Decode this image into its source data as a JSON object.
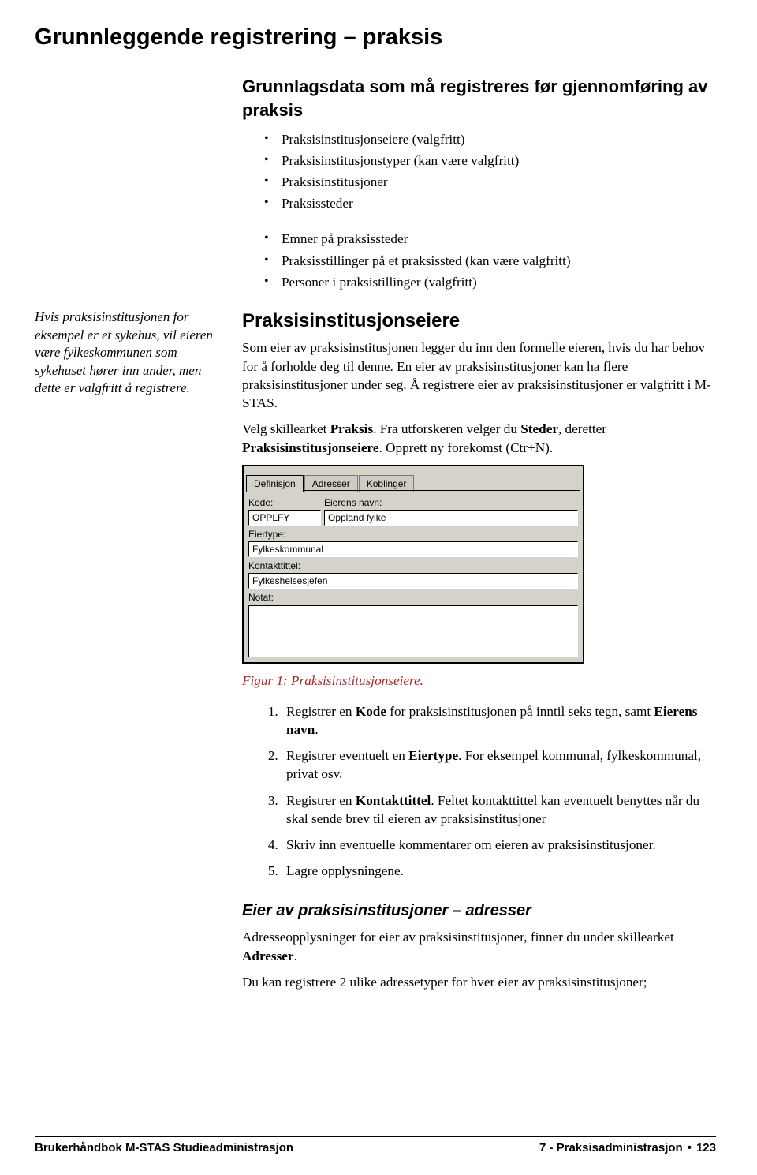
{
  "page_title": "Grunnleggende registrering – praksis",
  "intro": {
    "heading": "Grunnlagsdata som må registreres før gjennomføring av praksis",
    "bullets_a": [
      "Praksisinstitusjonseiere (valgfritt)",
      "Praksisinstitusjonstyper (kan være valgfritt)",
      "Praksisinstitusjoner",
      "Praksissteder"
    ],
    "bullets_b": [
      "Emner på praksissteder",
      "Praksisstillinger på et praksissted (kan være valgfritt)",
      "Personer i praksistillinger (valgfritt)"
    ]
  },
  "sidenote": "Hvis praksisinstitusjonen for eksempel er et sykehus, vil eieren være fylkeskommunen som sykehuset hører inn under, men dette er valgfritt å registrere.",
  "section1": {
    "heading": "Praksisinstitusjonseiere",
    "para_a": "Som eier av praksisinstitusjonen legger du inn den formelle eieren, hvis du har behov for å forholde deg til denne. En eier av praksisinstitusjoner kan ha flere praksisinstitusjoner under seg. Å registrere eier av praksisinstitusjoner er valgfritt i M-STAS.",
    "para_b_lead": "Velg skillearket ",
    "para_b_bold1": "Praksis",
    "para_b_mid": ". Fra utforskeren velger du ",
    "para_b_bold2": "Steder",
    "para_b_mid2": ", deretter ",
    "para_b_bold3": "Praksisinstitusjonseiere",
    "para_b_tail": ". Opprett ny forekomst (Ctr+N)."
  },
  "panel": {
    "tabs": {
      "t1_u": "D",
      "t1": "efinisjon",
      "t2_u": "A",
      "t2": "dresser",
      "t3": "Koblinger"
    },
    "labels": {
      "kode": "Kode:",
      "navn": "Eierens navn:",
      "eiertype": "Eiertype:",
      "kontakt": "Kontakttittel:",
      "notat": "Notat:"
    },
    "values": {
      "kode": "OPPLFY",
      "navn": "Oppland fylke",
      "eiertype": "Fylkeskommunal",
      "kontakt": "Fylkeshelsesjefen"
    }
  },
  "fig_caption": "Figur 1: Praksisinstitusjonseiere.",
  "steps": {
    "s1a": "Registrer en ",
    "s1b": "Kode",
    "s1c": " for praksisinstitusjonen på inntil seks tegn, samt ",
    "s1d": "Eierens navn",
    "s1e": ".",
    "s2a": "Registrer eventuelt en ",
    "s2b": "Eiertype",
    "s2c": ". For eksempel kommunal, fylkeskommunal, privat osv.",
    "s3a": "Registrer en ",
    "s3b": "Kontakttittel",
    "s3c": ". Feltet kontakttittel kan eventuelt benyttes når du skal sende brev til eieren av praksisinstitusjoner",
    "s4": "Skriv inn eventuelle kommentarer om eieren av praksisinstitusjoner.",
    "s5": "Lagre opplysningene."
  },
  "section2": {
    "heading": "Eier av praksisinstitusjoner – adresser",
    "p1a": "Adresseopplysninger for eier av praksisinstitusjoner, finner du under skillearket ",
    "p1b": "Adresser",
    "p1c": ".",
    "p2": "Du kan registrere 2 ulike adressetyper for hver eier av praksisinstitusjoner;"
  },
  "footer": {
    "left": "Brukerhåndbok M-STAS Studieadministrasjon",
    "right_a": "7 - Praksisadministrasjon",
    "right_b": "123"
  }
}
